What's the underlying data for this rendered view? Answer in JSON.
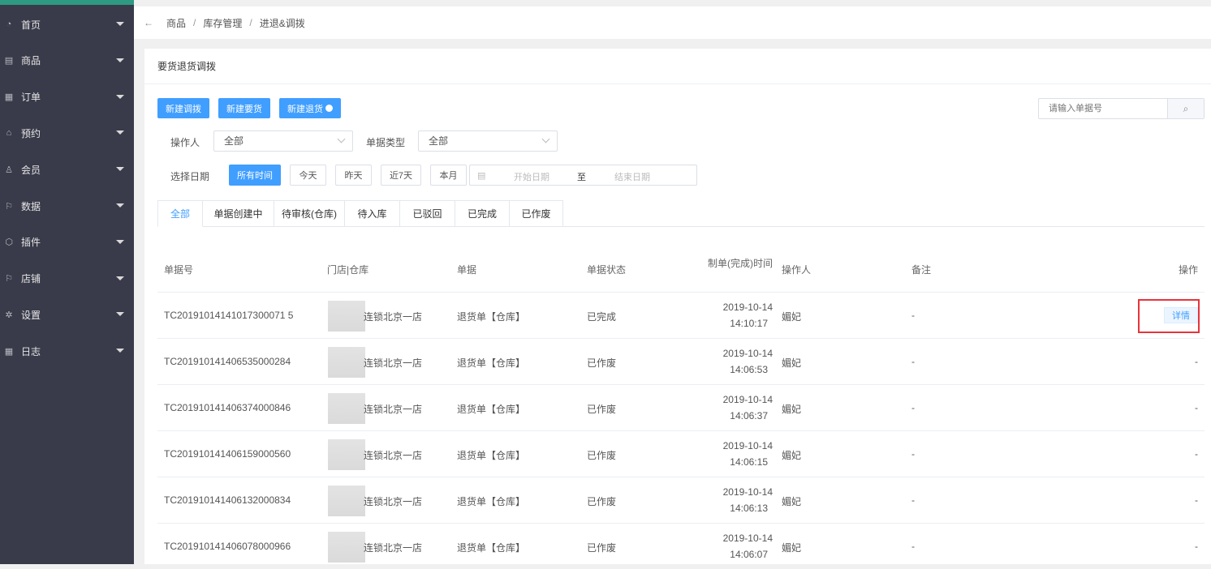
{
  "sidebar": {
    "items": [
      {
        "label": "首页",
        "icon": "dashboard-icon"
      },
      {
        "label": "商品",
        "icon": "document-icon"
      },
      {
        "label": "订单",
        "icon": "clipboard-icon"
      },
      {
        "label": "预约",
        "icon": "home-icon"
      },
      {
        "label": "会员",
        "icon": "user-icon"
      },
      {
        "label": "数据",
        "icon": "flag-icon"
      },
      {
        "label": "插件",
        "icon": "cube-icon"
      },
      {
        "label": "店铺",
        "icon": "flag-icon"
      },
      {
        "label": "设置",
        "icon": "gear-icon"
      },
      {
        "label": "日志",
        "icon": "clipboard-icon"
      }
    ]
  },
  "breadcrumb": [
    "商品",
    "库存管理",
    "进退&调拨"
  ],
  "card": {
    "title": "要货退货调拨"
  },
  "actions": {
    "new_transfer": "新建调拨",
    "new_request": "新建要货",
    "new_return": "新建退货"
  },
  "search": {
    "placeholder": "请输入单据号"
  },
  "filters": {
    "operator_label": "操作人",
    "operator_value": "全部",
    "type_label": "单据类型",
    "type_value": "全部",
    "date_label": "选择日期",
    "date_options": [
      "所有时间",
      "今天",
      "昨天",
      "近7天",
      "本月"
    ],
    "start_placeholder": "开始日期",
    "to": "至",
    "end_placeholder": "结束日期"
  },
  "tabs": [
    "全部",
    "单据创建中",
    "待审核(仓库)",
    "待入库",
    "已驳回",
    "已完成",
    "已作废"
  ],
  "table": {
    "headers": [
      "单据号",
      "门店|仓库",
      "单据",
      "单据状态",
      "制单(完成)时间",
      "操作人",
      "备注",
      "操作"
    ],
    "rows": [
      {
        "id": "TC20191014141017300071 5",
        "store": "连锁北京一店",
        "type": "退货单【仓库】",
        "status": "已完成",
        "date": "2019-10-14",
        "time": "14:10:17",
        "operator": "媚妃",
        "note": "-",
        "action": "详情"
      },
      {
        "id": "TC201910141406535000284",
        "store": "连锁北京一店",
        "type": "退货单【仓库】",
        "status": "已作废",
        "date": "2019-10-14",
        "time": "14:06:53",
        "operator": "媚妃",
        "note": "-",
        "action": "-"
      },
      {
        "id": "TC201910141406374000846",
        "store": "连锁北京一店",
        "type": "退货单【仓库】",
        "status": "已作废",
        "date": "2019-10-14",
        "time": "14:06:37",
        "operator": "媚妃",
        "note": "-",
        "action": "-"
      },
      {
        "id": "TC201910141406159000560",
        "store": "连锁北京一店",
        "type": "退货单【仓库】",
        "status": "已作废",
        "date": "2019-10-14",
        "time": "14:06:15",
        "operator": "媚妃",
        "note": "-",
        "action": "-"
      },
      {
        "id": "TC201910141406132000834",
        "store": "连锁北京一店",
        "type": "退货单【仓库】",
        "status": "已作废",
        "date": "2019-10-14",
        "time": "14:06:13",
        "operator": "媚妃",
        "note": "-",
        "action": "-"
      },
      {
        "id": "TC201910141406078000966",
        "store": "连锁北京一店",
        "type": "退货单【仓库】",
        "status": "已作废",
        "date": "2019-10-14",
        "time": "14:06:07",
        "operator": "媚妃",
        "note": "-",
        "action": "-"
      }
    ]
  }
}
